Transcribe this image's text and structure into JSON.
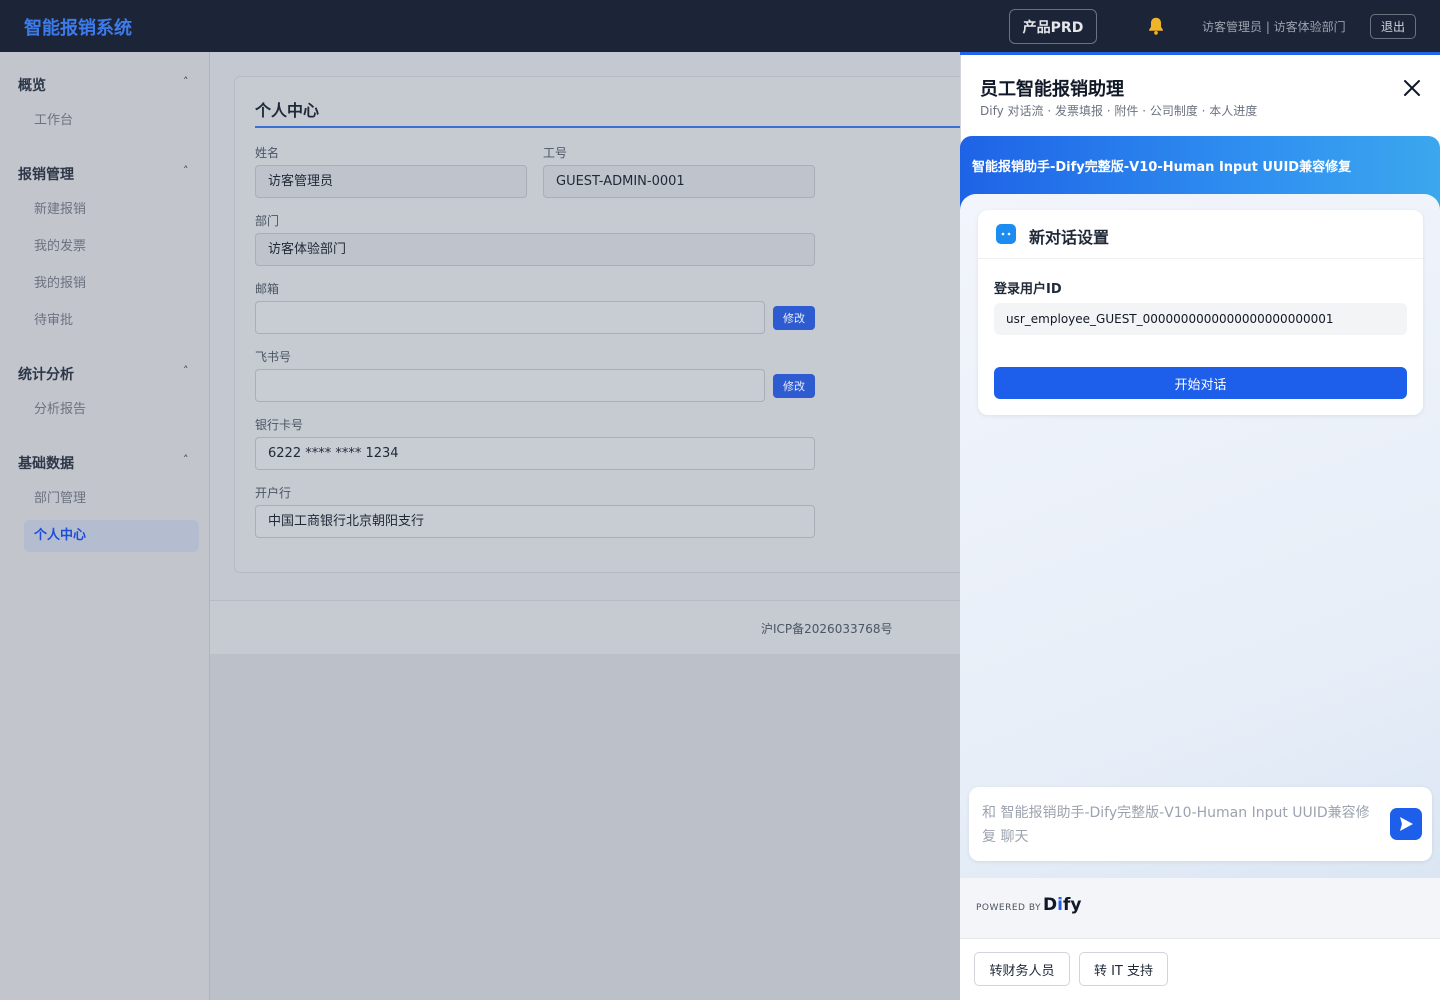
{
  "app": {
    "brand": "智能报销系统",
    "prd_button": "产品PRD",
    "user_info": "访客管理员 | 访客体验部门",
    "logout": "退出"
  },
  "sidebar": {
    "groups": [
      {
        "title": "概览",
        "items": [
          "工作台"
        ]
      },
      {
        "title": "报销管理",
        "items": [
          "新建报销",
          "我的发票",
          "我的报销",
          "待审批"
        ]
      },
      {
        "title": "统计分析",
        "items": [
          "分析报告"
        ]
      },
      {
        "title": "基础数据",
        "items": [
          "部门管理",
          "个人中心"
        ]
      }
    ],
    "caret": "˄",
    "active_item": "个人中心"
  },
  "profile": {
    "title": "个人中心",
    "name_label": "姓名",
    "name_value": "访客管理员",
    "id_label": "工号",
    "id_value": "GUEST-ADMIN-0001",
    "dept_label": "部门",
    "dept_value": "访客体验部门",
    "email_label": "邮箱",
    "email_value": "",
    "feishu_label": "飞书号",
    "feishu_value": "",
    "edit_label": "修改",
    "bank_card_label": "银行卡号",
    "bank_card_value": "6222 **** **** 1234",
    "bank_label": "开户行",
    "bank_value": "中国工商银行北京朝阳支行"
  },
  "footer": {
    "icp": "沪ICP备2026033768号"
  },
  "assistant": {
    "title": "员工智能报销助理",
    "subtitle": "Dify 对话流 · 发票填报 · 附件 · 公司制度 · 本人进度",
    "chat_title": "智能报销助手-Dify完整版-V10-Human Input UUID兼容修复",
    "setup_title": "新对话设置",
    "uid_label": "登录用户ID",
    "uid_value": "usr_employee_GUEST_0000000000000000000000001",
    "start_button": "开始对话",
    "composer_placeholder": "和 智能报销助手-Dify完整版-V10-Human Input UUID兼容修复 聊天",
    "powered_by": "POWERED BY",
    "dify_logo_a": "D",
    "dify_logo_i": "i",
    "dify_logo_b": "fy",
    "handoff_finance": "转财务人员",
    "handoff_it": "转 IT 支持"
  },
  "colors": {
    "topbar": "#1c2438",
    "brand": "#3d7bea",
    "accent": "#1d5eea",
    "active_nav": "#1d4ed8"
  },
  "icons": [
    "bell-icon",
    "close-icon",
    "robot-icon",
    "send-icon",
    "caret-up-icon"
  ]
}
